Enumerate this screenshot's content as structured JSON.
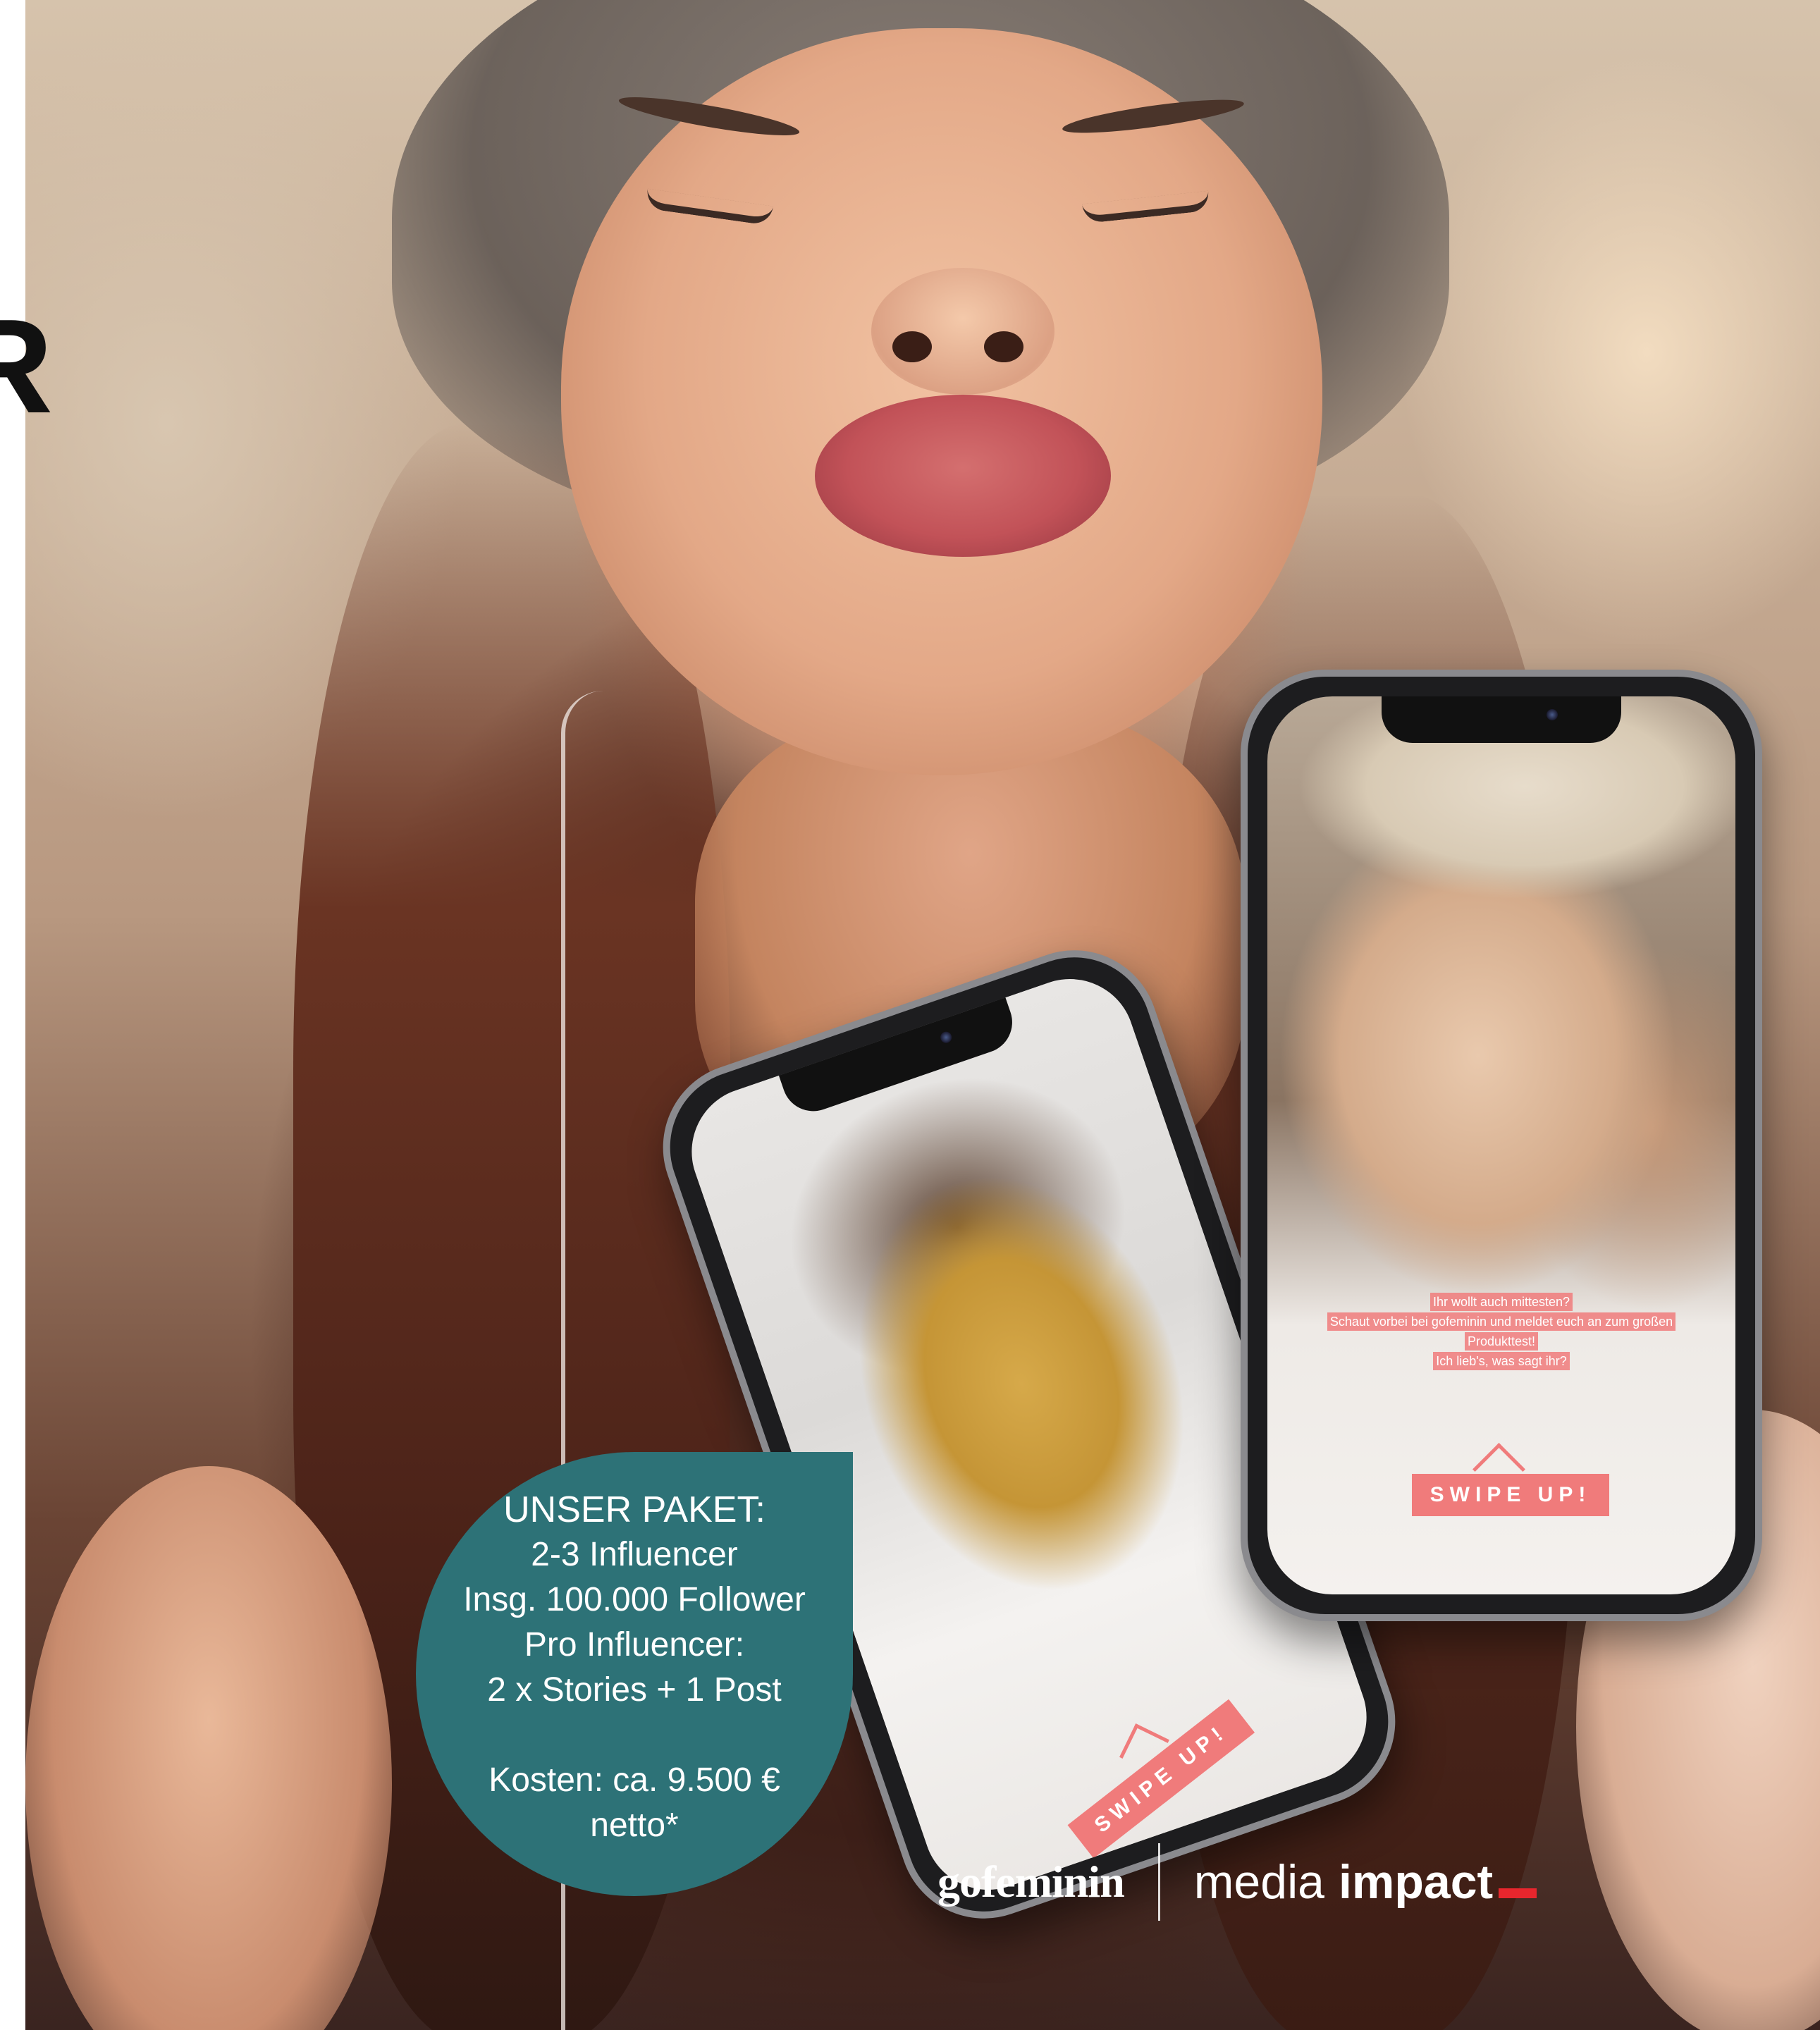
{
  "left_fragment": {
    "text": "R"
  },
  "phones": {
    "left": {
      "swipe_label": "SWIPE UP!"
    },
    "right": {
      "caption_lines": [
        "Ihr wollt auch mittesten?",
        "Schaut vorbei bei gofeminin und meldet euch an zum großen",
        "Produkttest!",
        "Ich lieb's, was sagt ihr?"
      ],
      "swipe_label": "SWIPE UP!"
    }
  },
  "package": {
    "title": "UNSER PAKET:",
    "lines": [
      "2-3 Influencer",
      "Insg. 100.000 Follower",
      "Pro Influencer:",
      "2 x Stories + 1 Post"
    ],
    "cost_line_1": "Kosten: ca. 9.500 €",
    "cost_line_2": "netto*"
  },
  "brands": {
    "gofeminin": "gofeminin",
    "media": "media",
    "impact": "impact"
  },
  "colors": {
    "package_bg": "#2d7277",
    "swipe_accent": "#f07b7b",
    "media_impact_red": "#e8262d"
  }
}
